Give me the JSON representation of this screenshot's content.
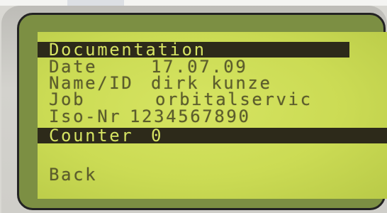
{
  "screen": {
    "title": "Documentation",
    "fields": {
      "date": {
        "label": "Date",
        "value": "17.07.09"
      },
      "name_id": {
        "label": "Name/ID",
        "value": "dirk kunze"
      },
      "job": {
        "label": "Job",
        "value": "orbitalservic"
      },
      "iso_nr": {
        "label": "Iso-Nr",
        "value": "1234567890"
      },
      "counter": {
        "label": "Counter",
        "value": "0"
      }
    },
    "back_label": "Back"
  },
  "colors": {
    "lcd_background": "#cbdb54",
    "lcd_text": "#5b5c2c",
    "highlight_bar": "#2d2a1a",
    "bezel": "#d3d2cd"
  }
}
